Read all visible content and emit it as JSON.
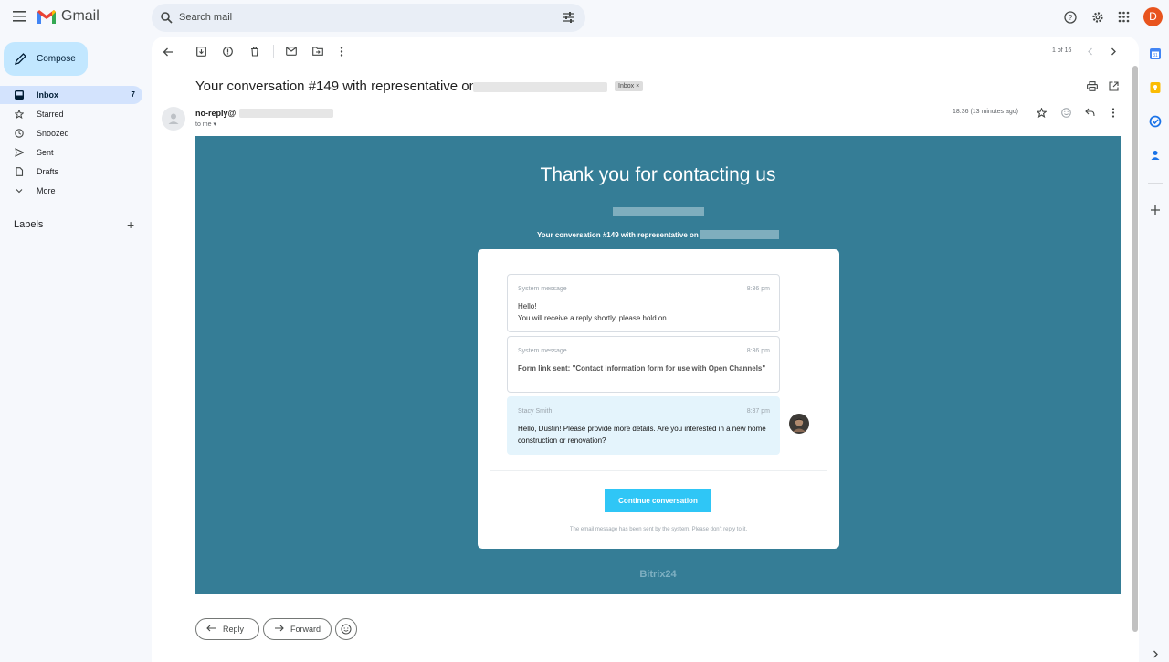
{
  "app": {
    "name": "Gmail",
    "avatar_letter": "D"
  },
  "search": {
    "placeholder": "Search mail"
  },
  "sidebar": {
    "compose_label": "Compose",
    "items": [
      {
        "label": "Inbox",
        "count": "7",
        "icon": "inbox-icon",
        "active": true
      },
      {
        "label": "Starred",
        "icon": "star-icon"
      },
      {
        "label": "Snoozed",
        "icon": "clock-icon"
      },
      {
        "label": "Sent",
        "icon": "send-icon"
      },
      {
        "label": "Drafts",
        "icon": "draft-icon"
      },
      {
        "label": "More",
        "icon": "chevron-down-icon"
      }
    ],
    "labels_heading": "Labels",
    "labels_add": "+"
  },
  "toolbar": {
    "pager": "1 of 16"
  },
  "message": {
    "subject": "Your conversation #149 with representative on",
    "label_chip": "Inbox ×",
    "sender": "no-reply@",
    "recipient": "to me",
    "time": "18:36 (13 minutes ago)"
  },
  "email": {
    "title": "Thank you for contacting us",
    "subtitle": "Your conversation #149 with representative on",
    "messages": [
      {
        "author": "System message",
        "time": "8:36 pm",
        "line1": "Hello!",
        "line2": "You will receive a reply shortly, please hold on."
      },
      {
        "author": "System message",
        "time": "8:36 pm",
        "line1": "Form link sent: \"Contact information form for use with Open Channels\"",
        "line2": ""
      },
      {
        "author": "Stacy Smith",
        "time": "8:37 pm",
        "line1": "Hello, Dustin! Please provide more details. Are you interested in a new home construction or renovation?",
        "line2": ""
      }
    ],
    "button": "Continue conversation",
    "footer_note": "The email message has been sent by the system. Please don't reply to it.",
    "brand": "Bitrix24"
  },
  "actions": {
    "reply": "Reply",
    "forward": "Forward"
  },
  "colors": {
    "email_bg": "#357d96",
    "accent": "#2fc6f6",
    "compose": "#c2e7ff",
    "active_nav": "#d3e3fd"
  }
}
